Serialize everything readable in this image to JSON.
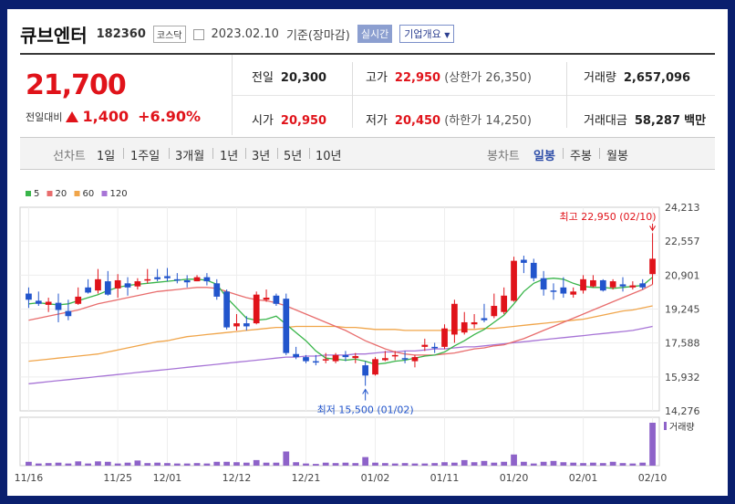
{
  "header": {
    "name": "큐브엔터",
    "code": "182360",
    "market": "코스닥",
    "date": "2023.02.10",
    "basis": "기준(장마감)",
    "realtime": "실시간",
    "company_info": "기업개요"
  },
  "price": {
    "current": "21,700",
    "change_label": "전일대비",
    "change": "1,400",
    "change_pct": "+6.90%"
  },
  "stats": {
    "prev_label": "전일",
    "prev": "20,300",
    "high_label": "고가",
    "high": "22,950",
    "upper_label": "(상한가",
    "upper": "26,350)",
    "volume_label": "거래량",
    "volume": "2,657,096",
    "open_label": "시가",
    "open": "20,950",
    "low_label": "저가",
    "low": "20,450",
    "lower_label": "(하한가",
    "lower": "14,250)",
    "amount_label": "거래대금",
    "amount": "58,287",
    "amount_unit": "백만"
  },
  "tabs": {
    "line_label": "선차트",
    "line": [
      "1일",
      "1주일",
      "3개월",
      "1년",
      "3년",
      "5년",
      "10년"
    ],
    "candle_label": "봉차트",
    "candle": [
      "일봉",
      "주봉",
      "월봉"
    ],
    "active": "일봉"
  },
  "colors": {
    "up": "#e0131a",
    "down": "#2255cc",
    "ma5": "#39b54a",
    "ma20": "#e86d6d",
    "ma60": "#f0a54a",
    "ma120": "#a774d6",
    "volume": "#8e63c9"
  },
  "chart_data": {
    "type": "candlestick",
    "legend": [
      "5",
      "20",
      "60",
      "120"
    ],
    "y_ticks": [
      "24,213",
      "22,557",
      "20,901",
      "19,245",
      "17,588",
      "15,932",
      "14,276"
    ],
    "ylim": [
      14276,
      24213
    ],
    "x_ticks": [
      "11/16",
      "11/25",
      "12/01",
      "12/12",
      "12/21",
      "01/02",
      "01/11",
      "01/20",
      "02/01",
      "02/10"
    ],
    "high_annotation": "최고 22,950 (02/10)",
    "low_annotation": "최저 15,500 (01/02)",
    "volume_label": "거래량",
    "candles": [
      [
        20000,
        19700,
        20300,
        19300
      ],
      [
        19650,
        19500,
        20100,
        19400
      ],
      [
        19450,
        19600,
        19800,
        19100
      ],
      [
        19550,
        19200,
        20000,
        18600
      ],
      [
        19150,
        18900,
        19700,
        18700
      ],
      [
        19500,
        19850,
        20300,
        19450
      ],
      [
        20300,
        20050,
        20700,
        20000
      ],
      [
        20150,
        20700,
        21200,
        20000
      ],
      [
        20600,
        19950,
        21100,
        19900
      ],
      [
        20250,
        20650,
        20950,
        19800
      ],
      [
        20500,
        20300,
        20800,
        19900
      ],
      [
        20350,
        20600,
        20750,
        20200
      ],
      [
        20650,
        20700,
        21200,
        20500
      ],
      [
        20800,
        20700,
        21200,
        20600
      ],
      [
        20850,
        20750,
        21250,
        20600
      ],
      [
        20700,
        20650,
        21000,
        20500
      ],
      [
        20650,
        20550,
        20900,
        20300
      ],
      [
        20600,
        20800,
        20900,
        20600
      ],
      [
        20800,
        20600,
        21000,
        20400
      ],
      [
        20500,
        19850,
        20700,
        19700
      ],
      [
        20100,
        18350,
        20200,
        18250
      ],
      [
        18400,
        18550,
        19000,
        18200
      ],
      [
        18550,
        18400,
        18900,
        18200
      ],
      [
        18550,
        19950,
        20100,
        18500
      ],
      [
        19700,
        19800,
        20200,
        19600
      ],
      [
        19900,
        19500,
        20000,
        19400
      ],
      [
        19750,
        17100,
        20000,
        17000
      ],
      [
        17050,
        16900,
        17400,
        16800
      ],
      [
        16900,
        16700,
        17000,
        16600
      ],
      [
        16700,
        16650,
        17000,
        16500
      ],
      [
        16800,
        16800,
        17100,
        16600
      ],
      [
        16700,
        17000,
        17100,
        16600
      ],
      [
        17000,
        16900,
        17200,
        16700
      ],
      [
        16850,
        16950,
        17100,
        16600
      ],
      [
        16500,
        16000,
        16700,
        15500
      ],
      [
        16050,
        16800,
        16900,
        16000
      ],
      [
        16750,
        16850,
        17200,
        16700
      ],
      [
        16950,
        17000,
        17200,
        16750
      ],
      [
        16850,
        16800,
        17200,
        16600
      ],
      [
        16700,
        16900,
        17000,
        16400
      ],
      [
        17400,
        17500,
        17800,
        17200
      ],
      [
        17400,
        17350,
        17600,
        17100
      ],
      [
        17400,
        18300,
        18500,
        17300
      ],
      [
        18000,
        19500,
        19700,
        17600
      ],
      [
        18100,
        18600,
        19100,
        18000
      ],
      [
        18500,
        18600,
        19000,
        18300
      ],
      [
        18800,
        18700,
        19500,
        18600
      ],
      [
        18900,
        19400,
        20000,
        18800
      ],
      [
        19100,
        19900,
        20300,
        19000
      ],
      [
        19650,
        21600,
        21800,
        19600
      ],
      [
        21650,
        21500,
        21850,
        21000
      ],
      [
        21500,
        20750,
        21700,
        20600
      ],
      [
        20750,
        20200,
        21100,
        19900
      ],
      [
        20150,
        20100,
        20500,
        19700
      ],
      [
        20300,
        20000,
        20800,
        19800
      ],
      [
        19950,
        20100,
        20300,
        19800
      ],
      [
        20150,
        20700,
        20900,
        20000
      ],
      [
        20350,
        20650,
        20900,
        20300
      ],
      [
        20650,
        20150,
        20700,
        20100
      ],
      [
        20300,
        20600,
        20700,
        20200
      ],
      [
        20450,
        20350,
        20800,
        20100
      ],
      [
        20300,
        20400,
        20600,
        20200
      ],
      [
        20500,
        20300,
        20700,
        20200
      ],
      [
        20950,
        21700,
        22950,
        20450
      ]
    ],
    "ma5": [
      19500,
      19550,
      19500,
      19450,
      19500,
      19650,
      19800,
      19950,
      20150,
      20300,
      20400,
      20450,
      20500,
      20550,
      20600,
      20650,
      20700,
      20700,
      20650,
      20450,
      19800,
      19300,
      18800,
      18700,
      18750,
      18900,
      18500,
      18100,
      17700,
      17200,
      16850,
      16800,
      16750,
      16800,
      16700,
      16550,
      16600,
      16700,
      16750,
      16850,
      16950,
      17000,
      17150,
      17450,
      17700,
      18000,
      18250,
      18600,
      18950,
      19500,
      20100,
      20500,
      20700,
      20750,
      20700,
      20500,
      20350,
      20300,
      20300,
      20250,
      20300,
      20350,
      20400,
      20800
    ],
    "ma20": [
      18700,
      18800,
      18900,
      19000,
      19100,
      19200,
      19350,
      19500,
      19600,
      19700,
      19800,
      19900,
      20000,
      20100,
      20150,
      20200,
      20250,
      20300,
      20300,
      20250,
      20100,
      19950,
      19800,
      19700,
      19650,
      19550,
      19400,
      19200,
      19000,
      18800,
      18600,
      18400,
      18200,
      17950,
      17700,
      17500,
      17300,
      17150,
      17050,
      17000,
      17000,
      17000,
      17050,
      17100,
      17200,
      17300,
      17350,
      17450,
      17500,
      17650,
      17800,
      18000,
      18200,
      18400,
      18600,
      18800,
      19000,
      19200,
      19400,
      19600,
      19800,
      20000,
      20200,
      20450
    ],
    "ma60": [
      16700,
      16750,
      16800,
      16850,
      16900,
      16950,
      17000,
      17050,
      17150,
      17250,
      17350,
      17450,
      17550,
      17650,
      17700,
      17800,
      17900,
      17950,
      18000,
      18050,
      18100,
      18150,
      18200,
      18250,
      18300,
      18350,
      18350,
      18400,
      18400,
      18400,
      18400,
      18400,
      18350,
      18350,
      18300,
      18250,
      18250,
      18250,
      18200,
      18200,
      18200,
      18200,
      18200,
      18200,
      18250,
      18250,
      18300,
      18300,
      18350,
      18400,
      18450,
      18500,
      18550,
      18600,
      18650,
      18700,
      18750,
      18850,
      18950,
      19050,
      19150,
      19200,
      19300,
      19400
    ],
    "ma120": [
      15600,
      15650,
      15700,
      15750,
      15800,
      15850,
      15900,
      15950,
      16000,
      16050,
      16100,
      16150,
      16200,
      16250,
      16300,
      16350,
      16400,
      16450,
      16500,
      16550,
      16600,
      16650,
      16700,
      16750,
      16800,
      16850,
      16900,
      16900,
      16950,
      16950,
      17000,
      17000,
      17000,
      17050,
      17050,
      17100,
      17150,
      17150,
      17200,
      17200,
      17250,
      17300,
      17300,
      17350,
      17400,
      17400,
      17450,
      17500,
      17550,
      17600,
      17650,
      17700,
      17750,
      17800,
      17850,
      17900,
      17950,
      18000,
      18050,
      18100,
      18150,
      18200,
      18300,
      18400
    ],
    "volume": [
      0.09,
      0.05,
      0.06,
      0.07,
      0.05,
      0.1,
      0.05,
      0.1,
      0.09,
      0.05,
      0.07,
      0.12,
      0.06,
      0.07,
      0.06,
      0.05,
      0.05,
      0.06,
      0.05,
      0.09,
      0.09,
      0.08,
      0.07,
      0.13,
      0.07,
      0.07,
      0.33,
      0.08,
      0.05,
      0.04,
      0.07,
      0.06,
      0.07,
      0.06,
      0.2,
      0.07,
      0.06,
      0.05,
      0.06,
      0.05,
      0.05,
      0.06,
      0.08,
      0.07,
      0.13,
      0.08,
      0.11,
      0.07,
      0.09,
      0.26,
      0.09,
      0.05,
      0.09,
      0.11,
      0.08,
      0.07,
      0.06,
      0.07,
      0.06,
      0.09,
      0.06,
      0.05,
      0.07,
      1.0
    ]
  }
}
